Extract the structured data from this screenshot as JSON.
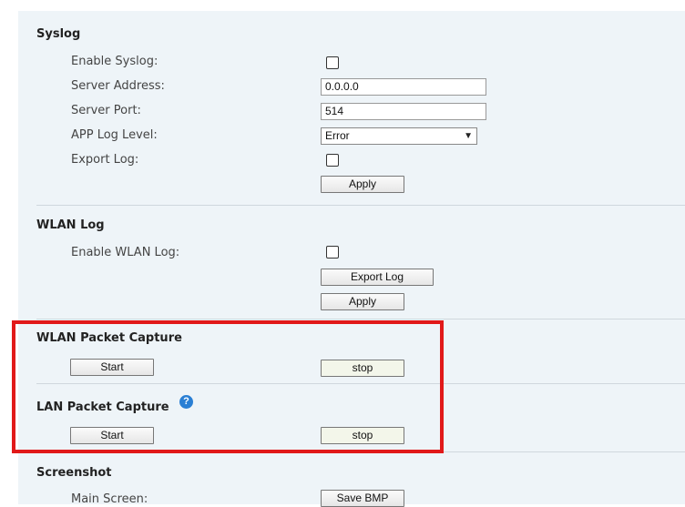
{
  "syslog": {
    "title": "Syslog",
    "enable_label": "Enable Syslog:",
    "server_address_label": "Server Address:",
    "server_address_value": "0.0.0.0",
    "server_port_label": "Server Port:",
    "server_port_value": "514",
    "app_log_level_label": "APP Log Level:",
    "app_log_level_value": "Error",
    "export_log_label": "Export Log:",
    "apply_label": "Apply"
  },
  "wlan_log": {
    "title": "WLAN Log",
    "enable_label": "Enable WLAN Log:",
    "export_button": "Export Log",
    "apply_label": "Apply"
  },
  "wlan_capture": {
    "title": "WLAN Packet Capture",
    "start_label": "Start",
    "stop_label": "stop"
  },
  "lan_capture": {
    "title": "LAN Packet Capture",
    "help_icon": "?",
    "start_label": "Start",
    "stop_label": "stop"
  },
  "screenshot": {
    "title": "Screenshot",
    "main_screen_label": "Main Screen:",
    "save_bmp_label": "Save BMP"
  },
  "colors": {
    "panel_bg": "#eef4f8",
    "highlight_border": "#e11919",
    "help_icon_bg": "#2a7fd4"
  }
}
